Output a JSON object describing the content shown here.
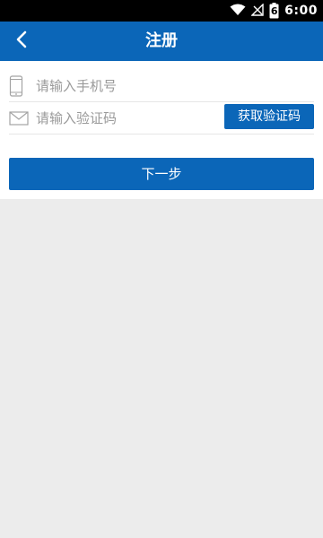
{
  "status_bar": {
    "time": "6:00",
    "battery_level": "6",
    "icons": [
      "wifi-icon",
      "signal-icon",
      "battery-icon"
    ]
  },
  "header": {
    "title": "注册",
    "back_icon": "chevron-left-icon"
  },
  "form": {
    "phone": {
      "placeholder": "请输入手机号",
      "value": "",
      "icon": "phone-icon"
    },
    "code": {
      "placeholder": "请输入验证码",
      "value": "",
      "icon": "mail-icon"
    },
    "get_code_label": "获取验证码"
  },
  "next_label": "下一步",
  "colors": {
    "primary": "#0b66b8",
    "background": "#ececec",
    "placeholder": "#9a9a9a"
  }
}
